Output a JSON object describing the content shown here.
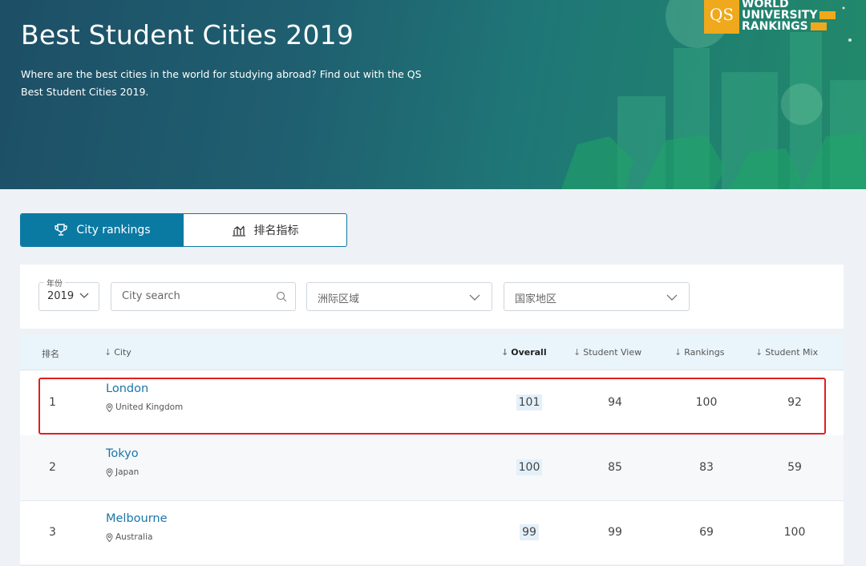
{
  "hero": {
    "title": "Best Student Cities 2019",
    "description": "Where are the best cities in the world for studying abroad? Find out with the QS Best Student Cities 2019."
  },
  "logo": {
    "box": "QS",
    "line1": "WORLD",
    "line2": "UNIVERSITY",
    "line3": "RANKINGS"
  },
  "tabs": [
    {
      "label": "City rankings",
      "icon": "trophy-icon",
      "active": true
    },
    {
      "label": "排名指标",
      "icon": "chart-icon",
      "active": false
    }
  ],
  "filters": {
    "year_legend": "年份",
    "year_value": "2019",
    "city_search_placeholder": "City search",
    "region_label": "洲际区域",
    "country_label": "国家地区"
  },
  "table": {
    "columns": [
      "排名",
      "City",
      "Overall",
      "Student View",
      "Rankings",
      "Student Mix"
    ],
    "rows": [
      {
        "rank": "1",
        "city": "London",
        "country": "United Kingdom",
        "overall": "101",
        "student_view": "94",
        "rankings": "100",
        "student_mix": "92"
      },
      {
        "rank": "2",
        "city": "Tokyo",
        "country": "Japan",
        "overall": "100",
        "student_view": "85",
        "rankings": "83",
        "student_mix": "59"
      },
      {
        "rank": "3",
        "city": "Melbourne",
        "country": "Australia",
        "overall": "99",
        "student_view": "99",
        "rankings": "69",
        "student_mix": "100"
      }
    ]
  },
  "colors": {
    "accent": "#0b7aa3",
    "highlight": "#e01e1e",
    "logo": "#f0a81c"
  }
}
